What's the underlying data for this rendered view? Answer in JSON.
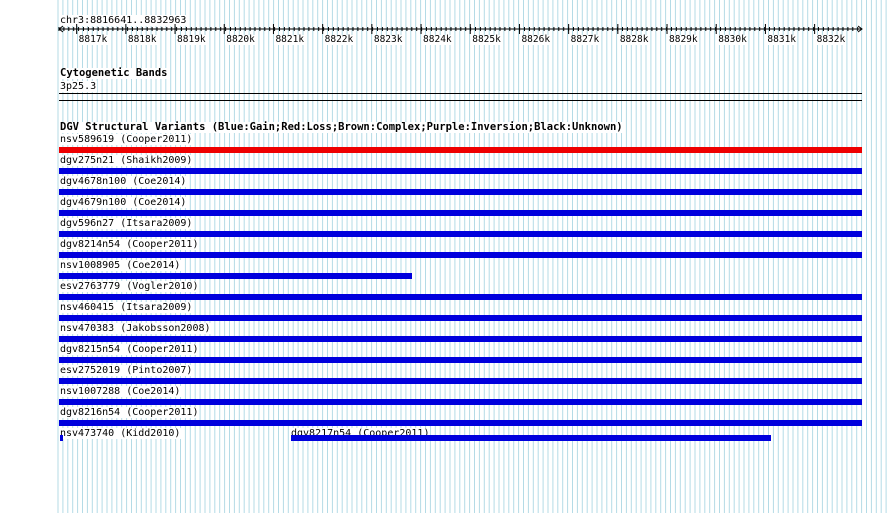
{
  "header": {
    "position": "chr3:8816641..8832963"
  },
  "ruler": {
    "ticks": [
      "8817k",
      "8818k",
      "8819k",
      "8820k",
      "8821k",
      "8822k",
      "8823k",
      "8824k",
      "8825k",
      "8826k",
      "8827k",
      "8828k",
      "8829k",
      "8830k",
      "8831k",
      "8832k"
    ]
  },
  "cytoband": {
    "title": "Cytogenetic Bands",
    "band": "3p25.3"
  },
  "dgv": {
    "title": "DGV Structural Variants (Blue:Gain;Red:Loss;Brown:Complex;Purple:Inversion;Black:Unknown)",
    "colors": {
      "gain": "#0000dd",
      "loss": "#ee0000"
    },
    "tracks": [
      {
        "label": "nsv589619 (Cooper2011)",
        "type": "loss"
      },
      {
        "label": "dgv275n21 (Shaikh2009)",
        "type": "gain"
      },
      {
        "label": "dgv4678n100 (Coe2014)",
        "type": "gain"
      },
      {
        "label": "dgv4679n100 (Coe2014)",
        "type": "gain"
      },
      {
        "label": "dgv596n27 (Itsara2009)",
        "type": "gain"
      },
      {
        "label": "dgv8214n54 (Cooper2011)",
        "type": "gain"
      },
      {
        "label": "nsv1008905 (Coe2014)",
        "type": "gain"
      },
      {
        "label": "esv2763779 (Vogler2010)",
        "type": "gain"
      },
      {
        "label": "nsv460415 (Itsara2009)",
        "type": "gain"
      },
      {
        "label": "nsv470383 (Jakobsson2008)",
        "type": "gain"
      },
      {
        "label": "dgv8215n54 (Cooper2011)",
        "type": "gain"
      },
      {
        "label": "esv2752019 (Pinto2007)",
        "type": "gain"
      },
      {
        "label": "nsv1007288 (Coe2014)",
        "type": "gain"
      },
      {
        "label": "dgv8216n54 (Cooper2011)",
        "type": "gain"
      }
    ],
    "last_row": [
      {
        "label": "nsv473740 (Kidd2010)",
        "type": "gain"
      },
      {
        "label": "dgv8217n54 (Cooper2011)",
        "type": "gain"
      }
    ]
  }
}
